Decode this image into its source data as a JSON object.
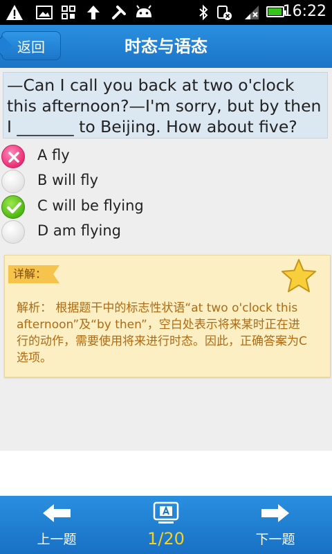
{
  "status_bar": {
    "time": "16:22",
    "battery_level": 0.95,
    "icons": [
      "warning-icon",
      "image-icon",
      "apps-icon",
      "upload-icon",
      "tools-icon",
      "android-icon",
      "bluetooth-icon",
      "sync-off-icon",
      "signal-icon",
      "battery-icon"
    ]
  },
  "header": {
    "back_label": "返回",
    "title": "时态与语态"
  },
  "question": {
    "text": "—Can I call you back at two o'clock this afternoon?—I'm sorry, but by then I _______ to Beijing. How about five?"
  },
  "options": [
    {
      "label": "A fly",
      "state": "wrong"
    },
    {
      "label": "B will fly",
      "state": "unselected"
    },
    {
      "label": "C will be flying",
      "state": "correct"
    },
    {
      "label": "D am flying",
      "state": "unselected"
    }
  ],
  "explanation": {
    "tag": "详解：",
    "text": "解析：  根据题干中的标志性状语“at two o'clock this afternoon”及“by then”，空白处表示将来某时正在进行的动作，需要使用将来进行时态。因此，正确答案为C选项。",
    "star_icon": "star-icon"
  },
  "footer": {
    "prev_label": "上一题",
    "next_label": "下一题",
    "counter": "1/20"
  },
  "colors": {
    "title_bar": "#1b74c7",
    "wrong": "#ea2f77",
    "correct": "#4eb715",
    "counter": "#f7d21c",
    "explain_text": "#b06a12"
  }
}
